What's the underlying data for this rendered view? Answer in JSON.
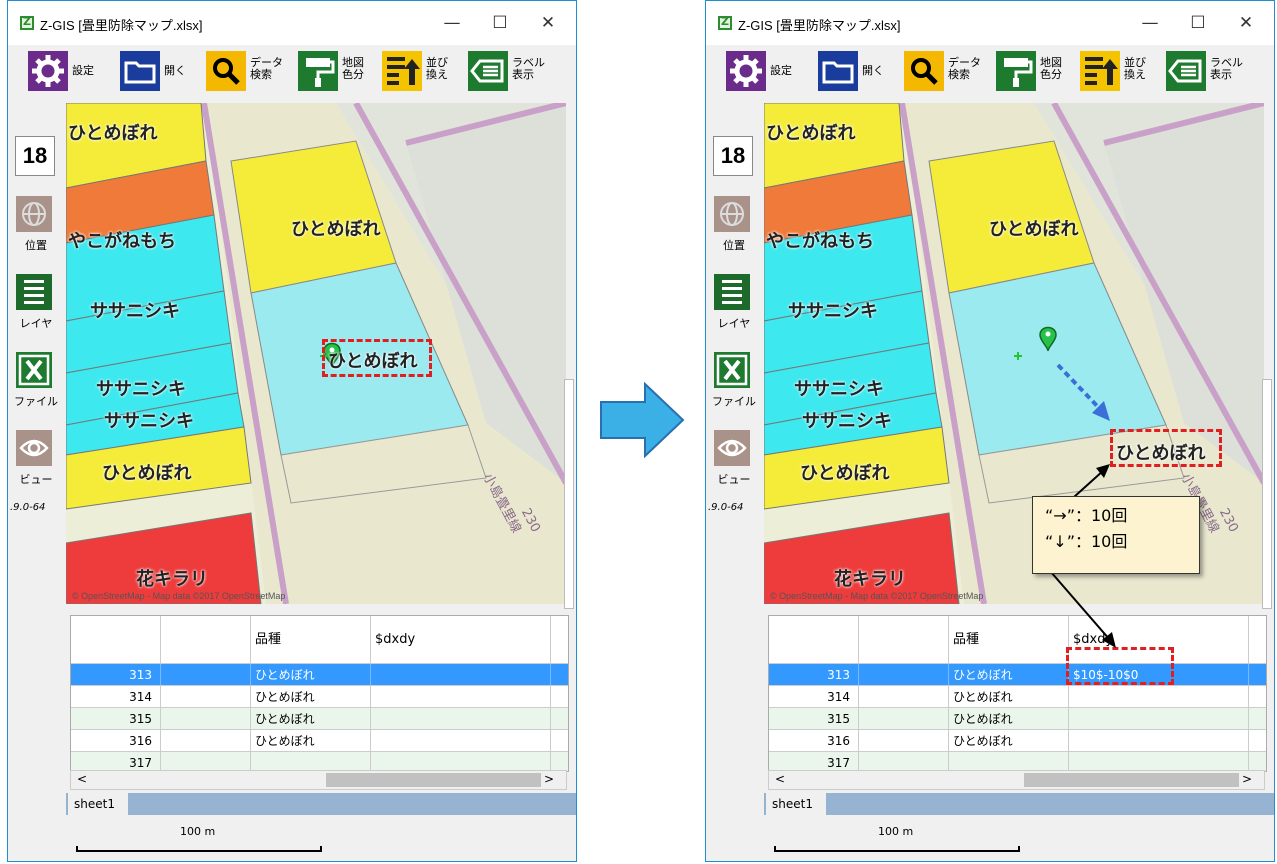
{
  "window": {
    "title": "Z-GIS [畳里防除マップ.xlsx]",
    "min_glyph": "—",
    "max_glyph": "☐",
    "close_glyph": "✕"
  },
  "toolbar": {
    "settings": "設定",
    "open": "開く",
    "data_search": "データ\n検索",
    "map_color": "地図\n色分",
    "sort": "並び\n換え",
    "label_display": "ラベル\n表示"
  },
  "sidebar": {
    "zoom": "18",
    "location": "位置",
    "layer": "レイヤ",
    "file": "ファイル",
    "view": "ビュー",
    "version": ".9.0-64"
  },
  "map": {
    "fields": {
      "f1": "ひとめぼれ",
      "f2": "やこがねもち",
      "f3": "ササニシキ",
      "f4": "ササニシキ",
      "f5": "ササニシキ",
      "f6": "ひとめぼれ",
      "f7": "花キラリ",
      "f8": "ひとめぼれ",
      "selected": "ひとめぼれ"
    },
    "road_name": "小島畳里線",
    "road_number": "230",
    "attribution": "© OpenStreetMap - Map data ©2017 OpenStreetMap"
  },
  "grid": {
    "headers": [
      "",
      "",
      "品種",
      "$dxdy"
    ],
    "rows_left": [
      {
        "id": "313",
        "variety": "ひとめぼれ",
        "dxdy": ""
      },
      {
        "id": "314",
        "variety": "ひとめぼれ",
        "dxdy": ""
      },
      {
        "id": "315",
        "variety": "ひとめぼれ",
        "dxdy": ""
      },
      {
        "id": "316",
        "variety": "ひとめぼれ",
        "dxdy": ""
      },
      {
        "id": "317",
        "variety": "",
        "dxdy": ""
      }
    ],
    "rows_right": [
      {
        "id": "313",
        "variety": "ひとめぼれ",
        "dxdy": "$10$-10$0"
      },
      {
        "id": "314",
        "variety": "ひとめぼれ",
        "dxdy": ""
      },
      {
        "id": "315",
        "variety": "ひとめぼれ",
        "dxdy": ""
      },
      {
        "id": "316",
        "variety": "ひとめぼれ",
        "dxdy": ""
      },
      {
        "id": "317",
        "variety": "",
        "dxdy": ""
      }
    ],
    "scroll_left": "<",
    "scroll_right": ">",
    "scroll_up": "^",
    "scroll_down": "v"
  },
  "sheet": {
    "tab": "sheet1"
  },
  "scale": {
    "label": "100 m"
  },
  "annotation": {
    "line1": "“→”：10回",
    "line2": "“↓”：10回"
  },
  "colors": {
    "yellow": "#f5ec3a",
    "orange": "#f07a3a",
    "cyan": "#3de8ef",
    "lightcyan": "#9beaf0",
    "red": "#ee3b3b",
    "highlight": "#e02020",
    "selection": "#3399ff"
  }
}
